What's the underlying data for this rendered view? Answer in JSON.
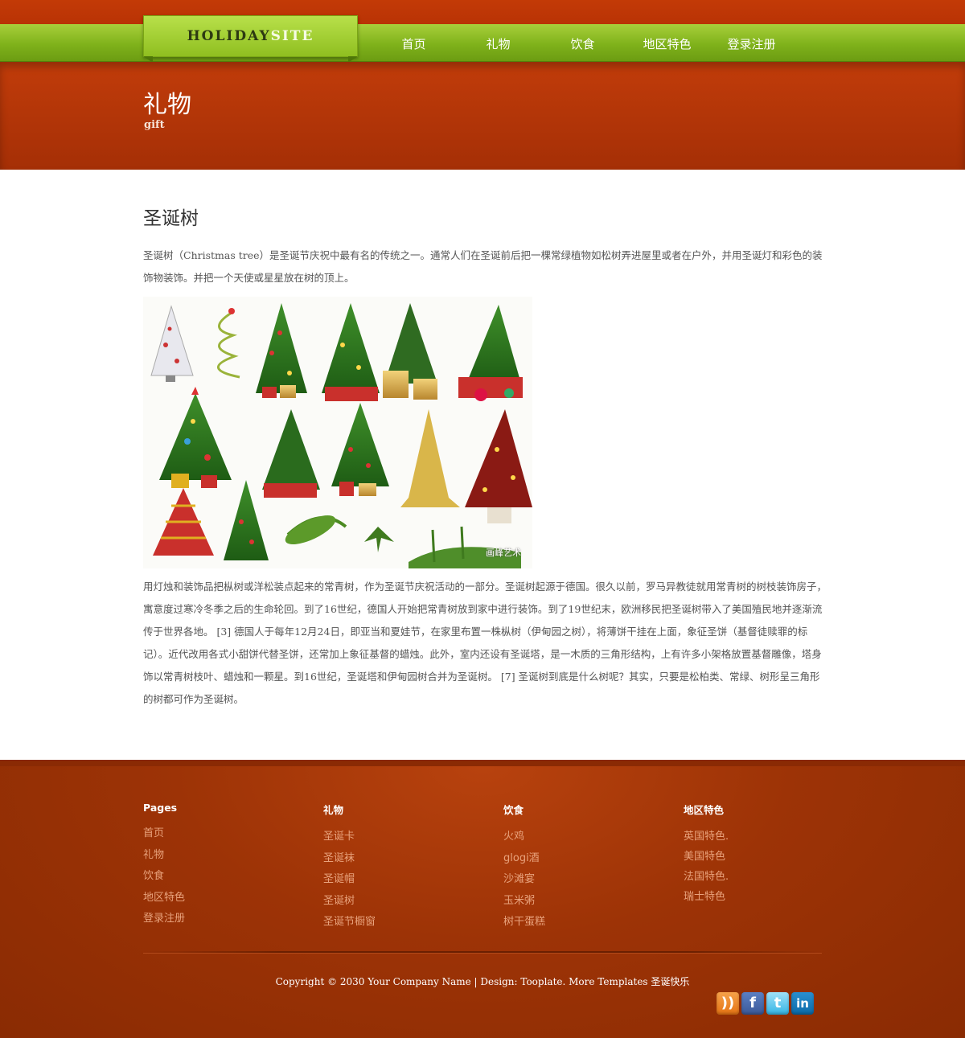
{
  "header": {
    "logo_main": "HOLIDAY",
    "logo_accent": "SITE",
    "nav": [
      "首页",
      "礼物",
      "饮食",
      "地区特色",
      "登录注册"
    ],
    "page_title": "礼物",
    "page_subtitle": "gift"
  },
  "article": {
    "title": "圣诞树",
    "intro": "圣诞树（Christmas tree）是圣诞节庆祝中最有名的传统之一。通常人们在圣诞前后把一棵常绿植物如松树弄进屋里或者在户外，并用圣诞灯和彩色的装饰物装饰。并把一个天使或星星放在树的顶上。",
    "image_watermark": "画峰艺术",
    "body": "用灯烛和装饰品把枞树或洋松装点起来的常青树，作为圣诞节庆祝活动的一部分。圣诞树起源于德国。很久以前，罗马异教徒就用常青树的树枝装饰房子，寓意度过寒冷冬季之后的生命轮回。到了16世纪，德国人开始把常青树放到家中进行装饰。到了19世纪末，欧洲移民把圣诞树带入了美国殖民地并逐渐流传于世界各地。 [3] 德国人于每年12月24日，即亚当和夏娃节，在家里布置一株枞树（伊甸园之树），将薄饼干挂在上面，象征圣饼（基督徒赎罪的标记）。近代改用各式小甜饼代替圣饼，还常加上象征基督的蜡烛。此外，室内还设有圣诞塔，是一木质的三角形结构，上有许多小架格放置基督雕像，塔身饰以常青树枝叶、蜡烛和一颗星。到16世纪，圣诞塔和伊甸园树合并为圣诞树。 [7] 圣诞树到底是什么树呢？其实，只要是松柏类、常绿、树形呈三角形的树都可作为圣诞树。"
  },
  "footer": {
    "columns": [
      {
        "heading": "Pages",
        "links": [
          "首页",
          "礼物",
          "饮食",
          "地区特色",
          "登录注册"
        ]
      },
      {
        "heading": "礼物",
        "links": [
          "圣诞卡",
          "圣诞袜",
          "圣诞帽",
          "圣诞树",
          "圣诞节橱窗"
        ]
      },
      {
        "heading": "饮食",
        "links": [
          "火鸡",
          "glogi酒",
          "沙滩宴",
          "玉米粥",
          "树干蛋糕"
        ]
      },
      {
        "heading": "地区特色",
        "links": [
          "英国特色.",
          "美国特色",
          "法国特色.",
          "瑞士特色"
        ]
      }
    ],
    "copyright": "Copyright © 2030 Your Company Name | Design: Tooplate. More Templates 圣诞快乐",
    "social": [
      {
        "icon": "rss-icon",
        "glyph": "))"
      },
      {
        "icon": "facebook-icon",
        "glyph": "f"
      },
      {
        "icon": "twitter-icon",
        "glyph": "t"
      },
      {
        "icon": "linkedin-icon",
        "glyph": "in"
      }
    ]
  },
  "colors": {
    "banner": "#b23506",
    "nav_green": "#8fbf20",
    "footer": "#9d3306",
    "footer_link": "#e8a27c"
  }
}
